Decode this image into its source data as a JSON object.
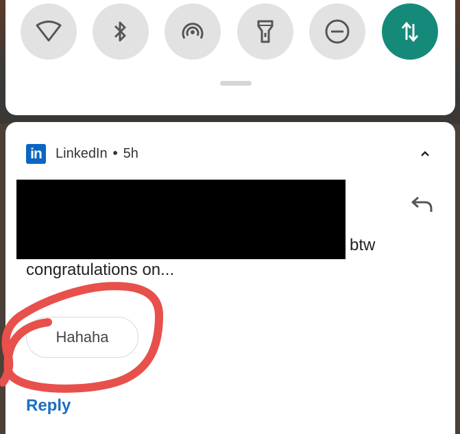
{
  "quick_settings": {
    "tiles": [
      {
        "icon": "wifi-icon",
        "active": false
      },
      {
        "icon": "bluetooth-icon",
        "active": false
      },
      {
        "icon": "hotspot-icon",
        "active": false
      },
      {
        "icon": "flashlight-icon",
        "active": false
      },
      {
        "icon": "do-not-disturb-icon",
        "active": false
      },
      {
        "icon": "mobile-data-icon",
        "active": true
      }
    ]
  },
  "notification": {
    "app_name": "LinkedIn",
    "separator": "•",
    "time": "5h",
    "logo_text": "in",
    "message_tail": "btw",
    "message_line2": "congratulations on...",
    "smart_reply": "Hahaha",
    "reply_label": "Reply"
  },
  "colors": {
    "accent_active_tile": "#158a7a",
    "linkedin_blue": "#0a66c2",
    "reply_link": "#1a6fbf",
    "annotation_red": "#e8504c"
  }
}
